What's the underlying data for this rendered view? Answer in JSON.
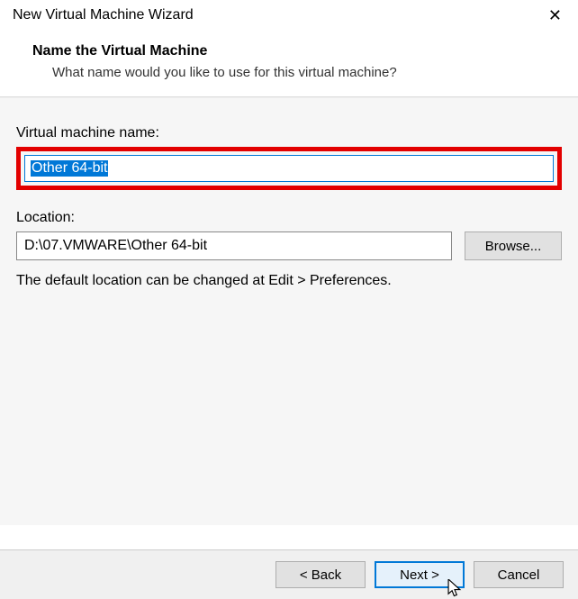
{
  "window": {
    "title": "New Virtual Machine Wizard"
  },
  "header": {
    "title": "Name the Virtual Machine",
    "subtitle": "What name would you like to use for this virtual machine?"
  },
  "form": {
    "name_label": "Virtual machine name:",
    "name_value": "Other 64-bit",
    "location_label": "Location:",
    "location_value": "D:\\07.VMWARE\\Other 64-bit",
    "browse_label": "Browse...",
    "hint": "The default location can be changed at Edit > Preferences."
  },
  "buttons": {
    "back": "< Back",
    "next": "Next >",
    "cancel": "Cancel"
  }
}
